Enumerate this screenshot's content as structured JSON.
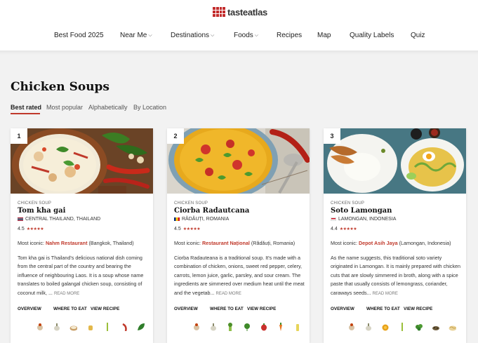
{
  "header": {
    "logo_text": "tasteatlas",
    "nav": [
      {
        "label": "Best Food 2025",
        "dropdown": false
      },
      {
        "label": "Near Me",
        "dropdown": true
      },
      {
        "label": "Destinations",
        "dropdown": true
      },
      {
        "label": "Foods",
        "dropdown": true
      },
      {
        "label": "Recipes",
        "dropdown": false
      },
      {
        "label": "Map",
        "dropdown": false
      },
      {
        "label": "Quality Labels",
        "dropdown": false
      },
      {
        "label": "Quiz",
        "dropdown": false
      }
    ]
  },
  "main": {
    "title": "Chicken Soups",
    "tabs": [
      {
        "label": "Best rated",
        "active": true
      },
      {
        "label": "Most popular",
        "active": false
      },
      {
        "label": "Alphabetically",
        "active": false
      },
      {
        "label": "By Location",
        "active": false
      }
    ],
    "cards": [
      {
        "rank": "1",
        "category": "CHICKEN SOUP",
        "name": "Tom kha gai",
        "origin": "CENTRAL THAILAND, THAILAND",
        "rating": "4.5",
        "stars": "★★★★★",
        "iconic_prefix": "Most iconic: ",
        "iconic_place": "Nahm Restaurant",
        "iconic_location": " (Bangkok, Thailand)",
        "description": "Tom kha gai is Thailand's delicious national dish coming from the central part of the country and bearing the influence of neighbouring Laos. It is a soup whose name translates to boiled galangal chicken soup, consisting of coconut milk, ...",
        "read_more": "READ MORE"
      },
      {
        "rank": "2",
        "category": "CHICKEN SOUP",
        "name": "Ciorba Radautcana",
        "origin": "RĂDĂUȚI, ROMANIA",
        "rating": "4.5",
        "stars": "★★★★★",
        "iconic_prefix": "Most iconic: ",
        "iconic_place": "Restaurant Național",
        "iconic_location": " (Rădăuți, Romania)",
        "description": "Ciorba Radauteana is a traditional soup. It's made with a combination of chicken, onions, sweet red pepper, celery, carrots, lemon juice, garlic, parsley, and sour cream. The ingredients are simmered over medium heat until the meat and the vegetab...",
        "read_more": "READ MORE"
      },
      {
        "rank": "3",
        "category": "CHICKEN SOUP",
        "name": "Soto Lamongan",
        "origin": "LAMONGAN, INDONESIA",
        "rating": "4.4",
        "stars": "★★★★★",
        "iconic_prefix": "Most iconic: ",
        "iconic_place": "Depot Asih Jaya",
        "iconic_location": " (Lamongan, Indonesia)",
        "description": "As the name suggests, this traditional soto variety originated in Lamongan. It is mainly prepared with chicken cuts that are slowly simmered in broth, along with a spice paste that usually consists of lemongrass, coriander, caraways seeds...",
        "read_more": "READ MORE"
      }
    ],
    "actions": {
      "overview": "OVERVIEW",
      "where": "WHERE TO EAT",
      "recipe": "VIEW RECIPE"
    }
  },
  "colors": {
    "accent": "#c0392b",
    "background": "#f2f2f2"
  }
}
